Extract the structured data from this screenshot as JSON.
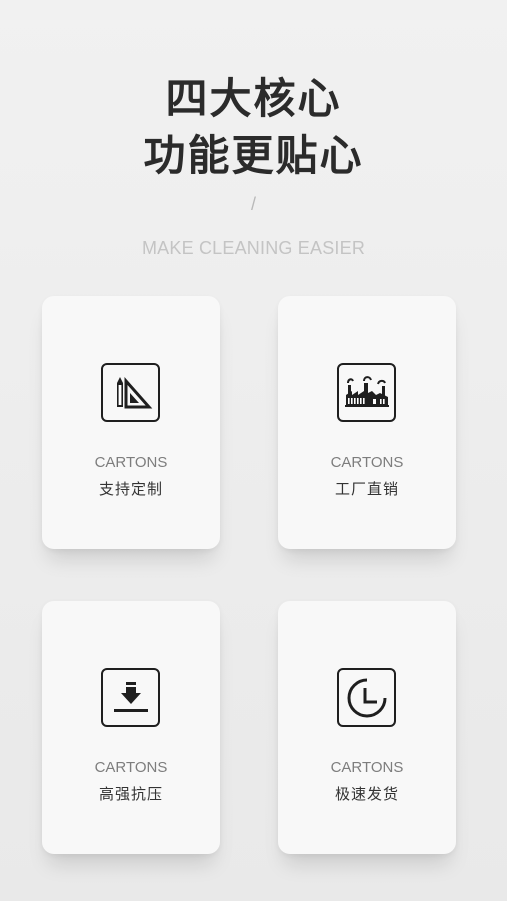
{
  "header": {
    "title_line1": "四大核心",
    "title_line2": "功能更贴心",
    "divider": "/",
    "tagline": "MAKE CLEANING EASIER"
  },
  "features": [
    {
      "icon": "ruler-pencil-icon",
      "label_en": "CARTONS",
      "label_cn": "支持定制"
    },
    {
      "icon": "factory-icon",
      "label_en": "CARTONS",
      "label_cn": "工厂直销"
    },
    {
      "icon": "press-down-icon",
      "label_en": "CARTONS",
      "label_cn": "高强抗压"
    },
    {
      "icon": "clock-icon",
      "label_en": "CARTONS",
      "label_cn": "极速发货"
    }
  ],
  "colors": {
    "background": "#ededed",
    "card": "#f8f8f8",
    "title": "#2b2b2b",
    "tagline": "#c4c4c4"
  }
}
